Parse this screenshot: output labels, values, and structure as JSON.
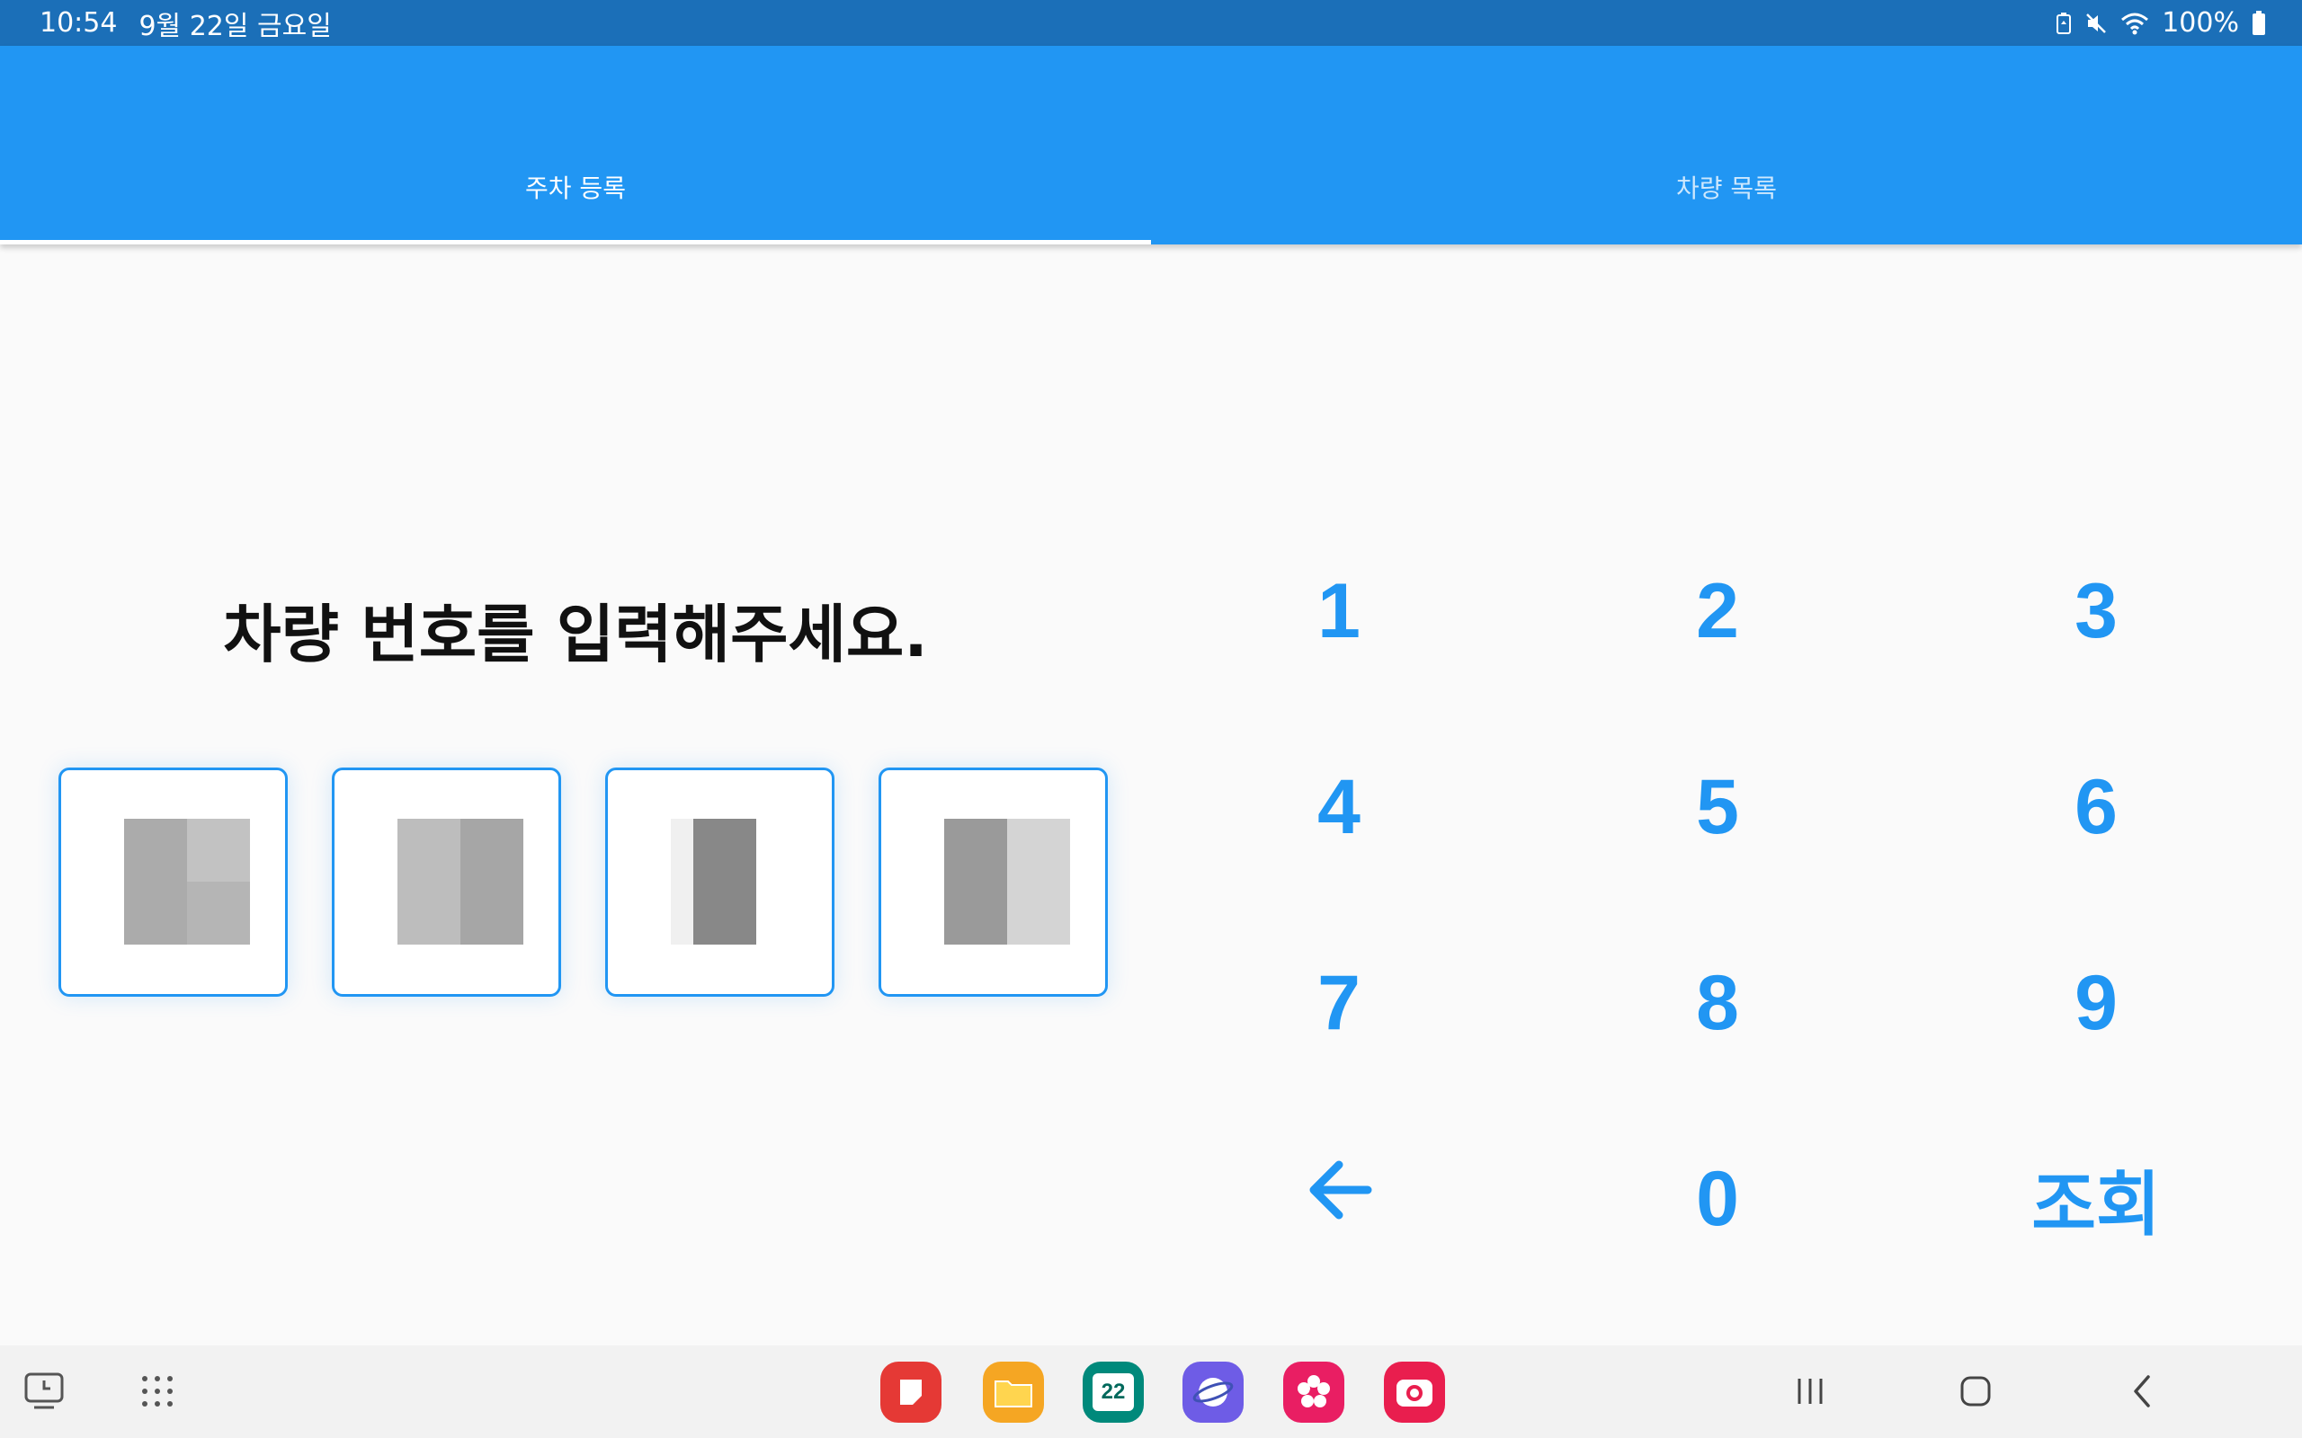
{
  "status_bar": {
    "time": "10:54",
    "date": "9월 22일 금요일",
    "battery": "100%",
    "icons": [
      "battery-saver-icon",
      "mute-icon",
      "wifi-icon",
      "battery-icon"
    ]
  },
  "tabs": [
    {
      "label": "주차 등록",
      "selected": true
    },
    {
      "label": "차량 목록",
      "selected": false
    }
  ],
  "input_panel": {
    "prompt": "차량 번호를 입력해주세요.",
    "digit_count": 4
  },
  "keypad": {
    "rows": [
      [
        "1",
        "2",
        "3"
      ],
      [
        "4",
        "5",
        "6"
      ],
      [
        "7",
        "8",
        "9"
      ]
    ],
    "back_icon": "arrow-left-icon",
    "zero": "0",
    "search_label": "조회"
  },
  "colors": {
    "status_bar": "#1b6fb8",
    "primary": "#2196f3",
    "background": "#fafafa",
    "text": "#111111"
  },
  "nav_bar": {
    "left_icons": [
      "recent-screen-icon",
      "app-grid-icon"
    ],
    "apps": [
      {
        "name": "notes-app-icon",
        "color": "#e53935",
        "label": ""
      },
      {
        "name": "files-app-icon",
        "color": "#f5a623",
        "label": ""
      },
      {
        "name": "calendar-app-icon",
        "color": "#00897b",
        "label": "22"
      },
      {
        "name": "internet-app-icon",
        "color": "#6e5ce6",
        "label": ""
      },
      {
        "name": "flower-app-icon",
        "color": "#e91e63",
        "label": ""
      },
      {
        "name": "camera-app-icon",
        "color": "#e91e4e",
        "label": ""
      }
    ],
    "system_buttons": [
      "recents-button",
      "home-button",
      "back-button"
    ]
  }
}
